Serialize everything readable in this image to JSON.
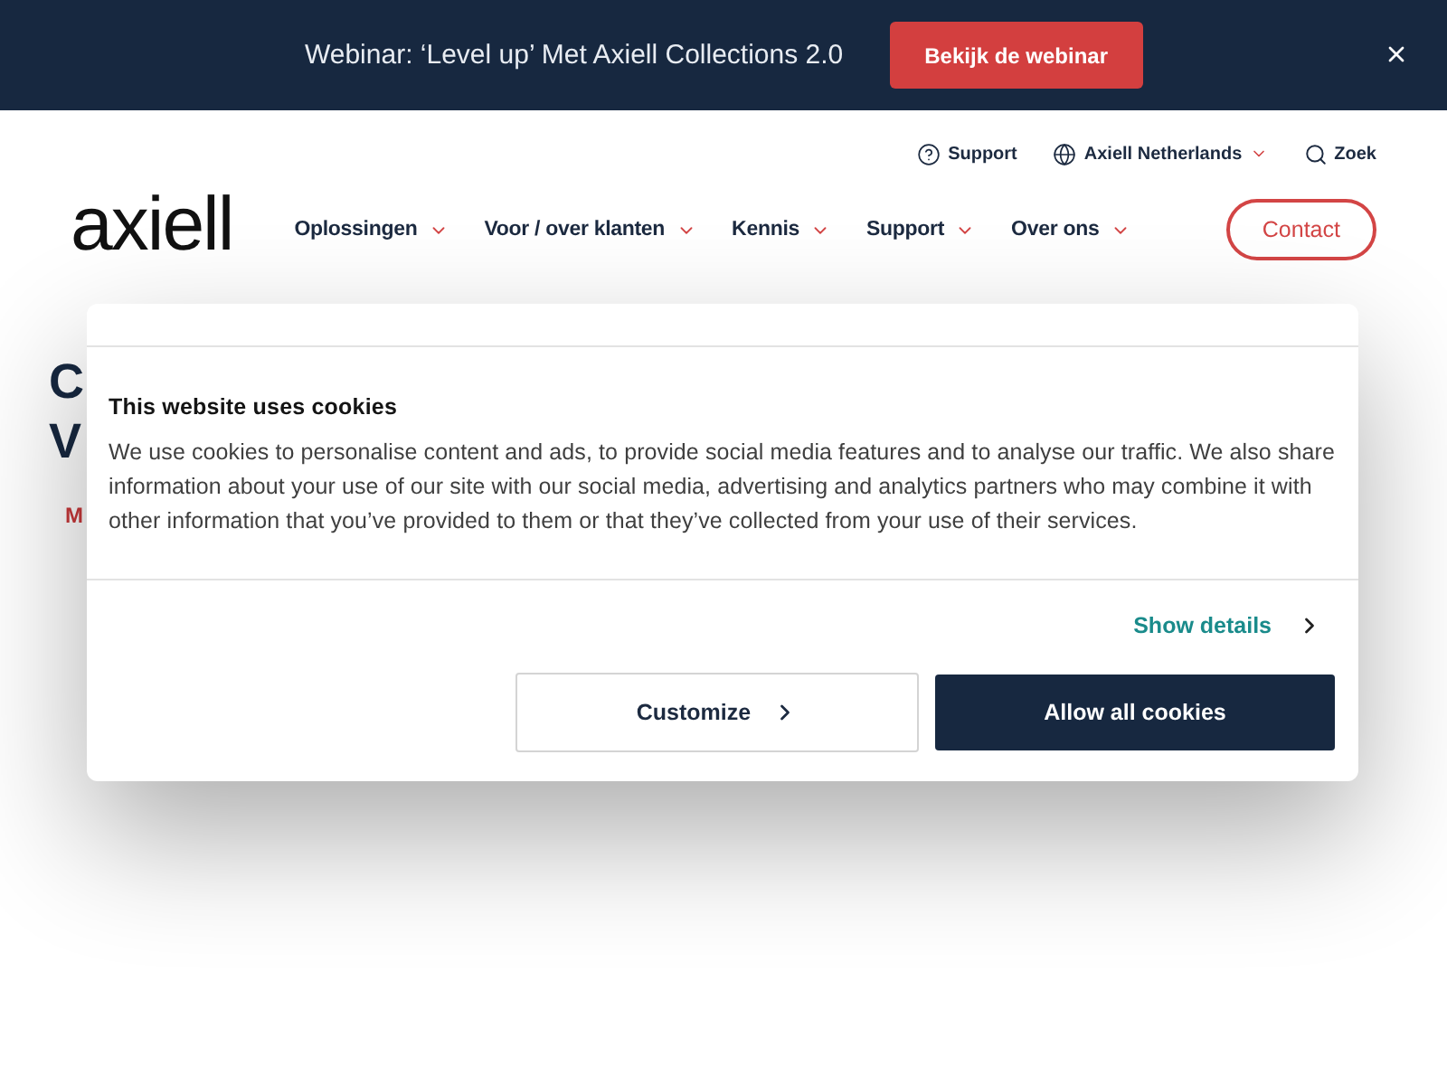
{
  "announcement_bar": {
    "text": "Webinar: ‘Level up’ Met Axiell Collections 2.0",
    "button": "Bekijk de webinar"
  },
  "utility_nav": [
    {
      "kind": "help",
      "label": "Support"
    },
    {
      "kind": "region",
      "label": "Axiell Netherlands"
    },
    {
      "kind": "search",
      "label": "Zoek"
    }
  ],
  "header": {
    "logo": "axiell",
    "nav": [
      {
        "label": "Oplossingen"
      },
      {
        "label": "Voor / over klanten"
      },
      {
        "label": "Kennis"
      },
      {
        "label": "Support"
      },
      {
        "label": "Over ons"
      }
    ],
    "contact_button": "Contact"
  },
  "page": {
    "heading_lines": [
      "C",
      "V"
    ],
    "meta": "M"
  },
  "cookie_dialog": {
    "title": "This website uses cookies",
    "body": "We use cookies to personalise content and ads, to provide social media features and to analyse our traffic. We also share information about your use of our site with our social media, advertising and analytics partners who may combine it with other information that you’ve provided to them or that they’ve collected from your use of their services.",
    "details_link": "Show details",
    "buttons": [
      {
        "kind": "secondary",
        "label": "Customize"
      },
      {
        "kind": "primary",
        "label": "Allow all cookies"
      }
    ]
  }
}
